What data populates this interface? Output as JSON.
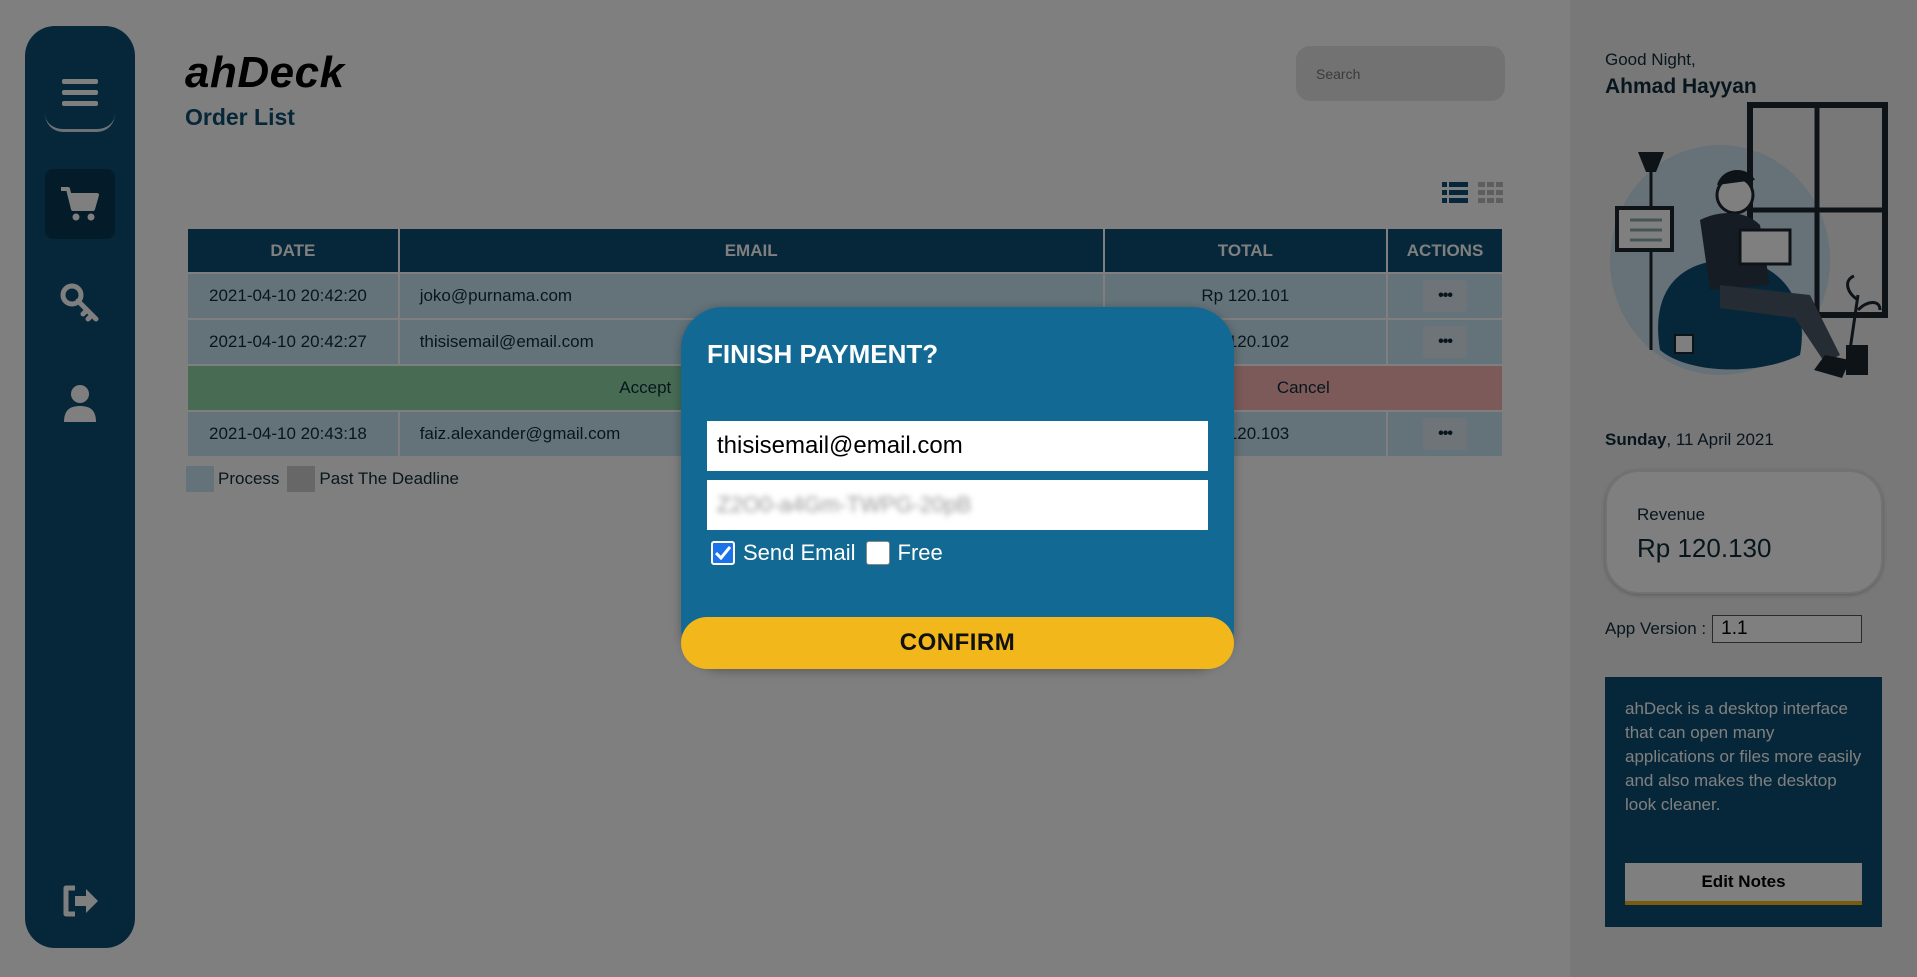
{
  "app": {
    "brand": "ahDeck",
    "subtitle": "Order List"
  },
  "sidebar": {
    "items": [
      {
        "icon": "menu-icon"
      },
      {
        "icon": "cart-icon",
        "active": true
      },
      {
        "icon": "key-icon"
      },
      {
        "icon": "user-icon"
      },
      {
        "icon": "logout-icon"
      }
    ]
  },
  "search": {
    "placeholder": "Search"
  },
  "table": {
    "headers": [
      "DATE",
      "EMAIL",
      "TOTAL",
      "ACTIONS"
    ],
    "rows": [
      {
        "date": "2021-04-10 20:42:20",
        "email": "joko@purnama.com",
        "total": "Rp 120.101",
        "action": "•••"
      },
      {
        "date": "2021-04-10 20:42:27",
        "email": "thisisemail@email.com",
        "total": "Rp 120.102",
        "action": "•••"
      },
      {
        "date": "2021-04-10 20:43:18",
        "email": "faiz.alexander@gmail.com",
        "total": "Rp 120.103",
        "action": "•••"
      }
    ],
    "expanded_row": {
      "accept": "Accept",
      "cancel": "Cancel"
    }
  },
  "legend": {
    "items": [
      {
        "label": "Process",
        "color": "#c9e6f4"
      },
      {
        "label": "Past The Deadline",
        "color": "#cfcfcf"
      }
    ]
  },
  "right_panel": {
    "greeting": "Good Night,",
    "user_name": "Ahmad Hayyan",
    "date_day": "Sunday",
    "date_rest": ", 11 April 2021",
    "revenue_label": "Revenue",
    "revenue_value": "Rp 120.130",
    "app_version_label": "App Version :",
    "app_version_value": "1.1",
    "notes_text": "ahDeck is a desktop interface that can open many applications or files more easily and also makes the desktop look cleaner.",
    "edit_notes_label": "Edit Notes"
  },
  "modal": {
    "title": "FINISH PAYMENT?",
    "email_value": "thisisemail@email.com",
    "code_value": "Z2O0-a4Gm-TWPG-20pB",
    "send_email_label": "Send Email",
    "send_email_checked": true,
    "free_label": "Free",
    "free_checked": false,
    "confirm_label": "CONFIRM"
  },
  "colors": {
    "primary": "#0d4f73",
    "modal": "#126a94",
    "accent": "#f2b71b",
    "process": "#c9e6f4",
    "accept": "#8fd8a6",
    "cancel": "#f8b4b4"
  }
}
